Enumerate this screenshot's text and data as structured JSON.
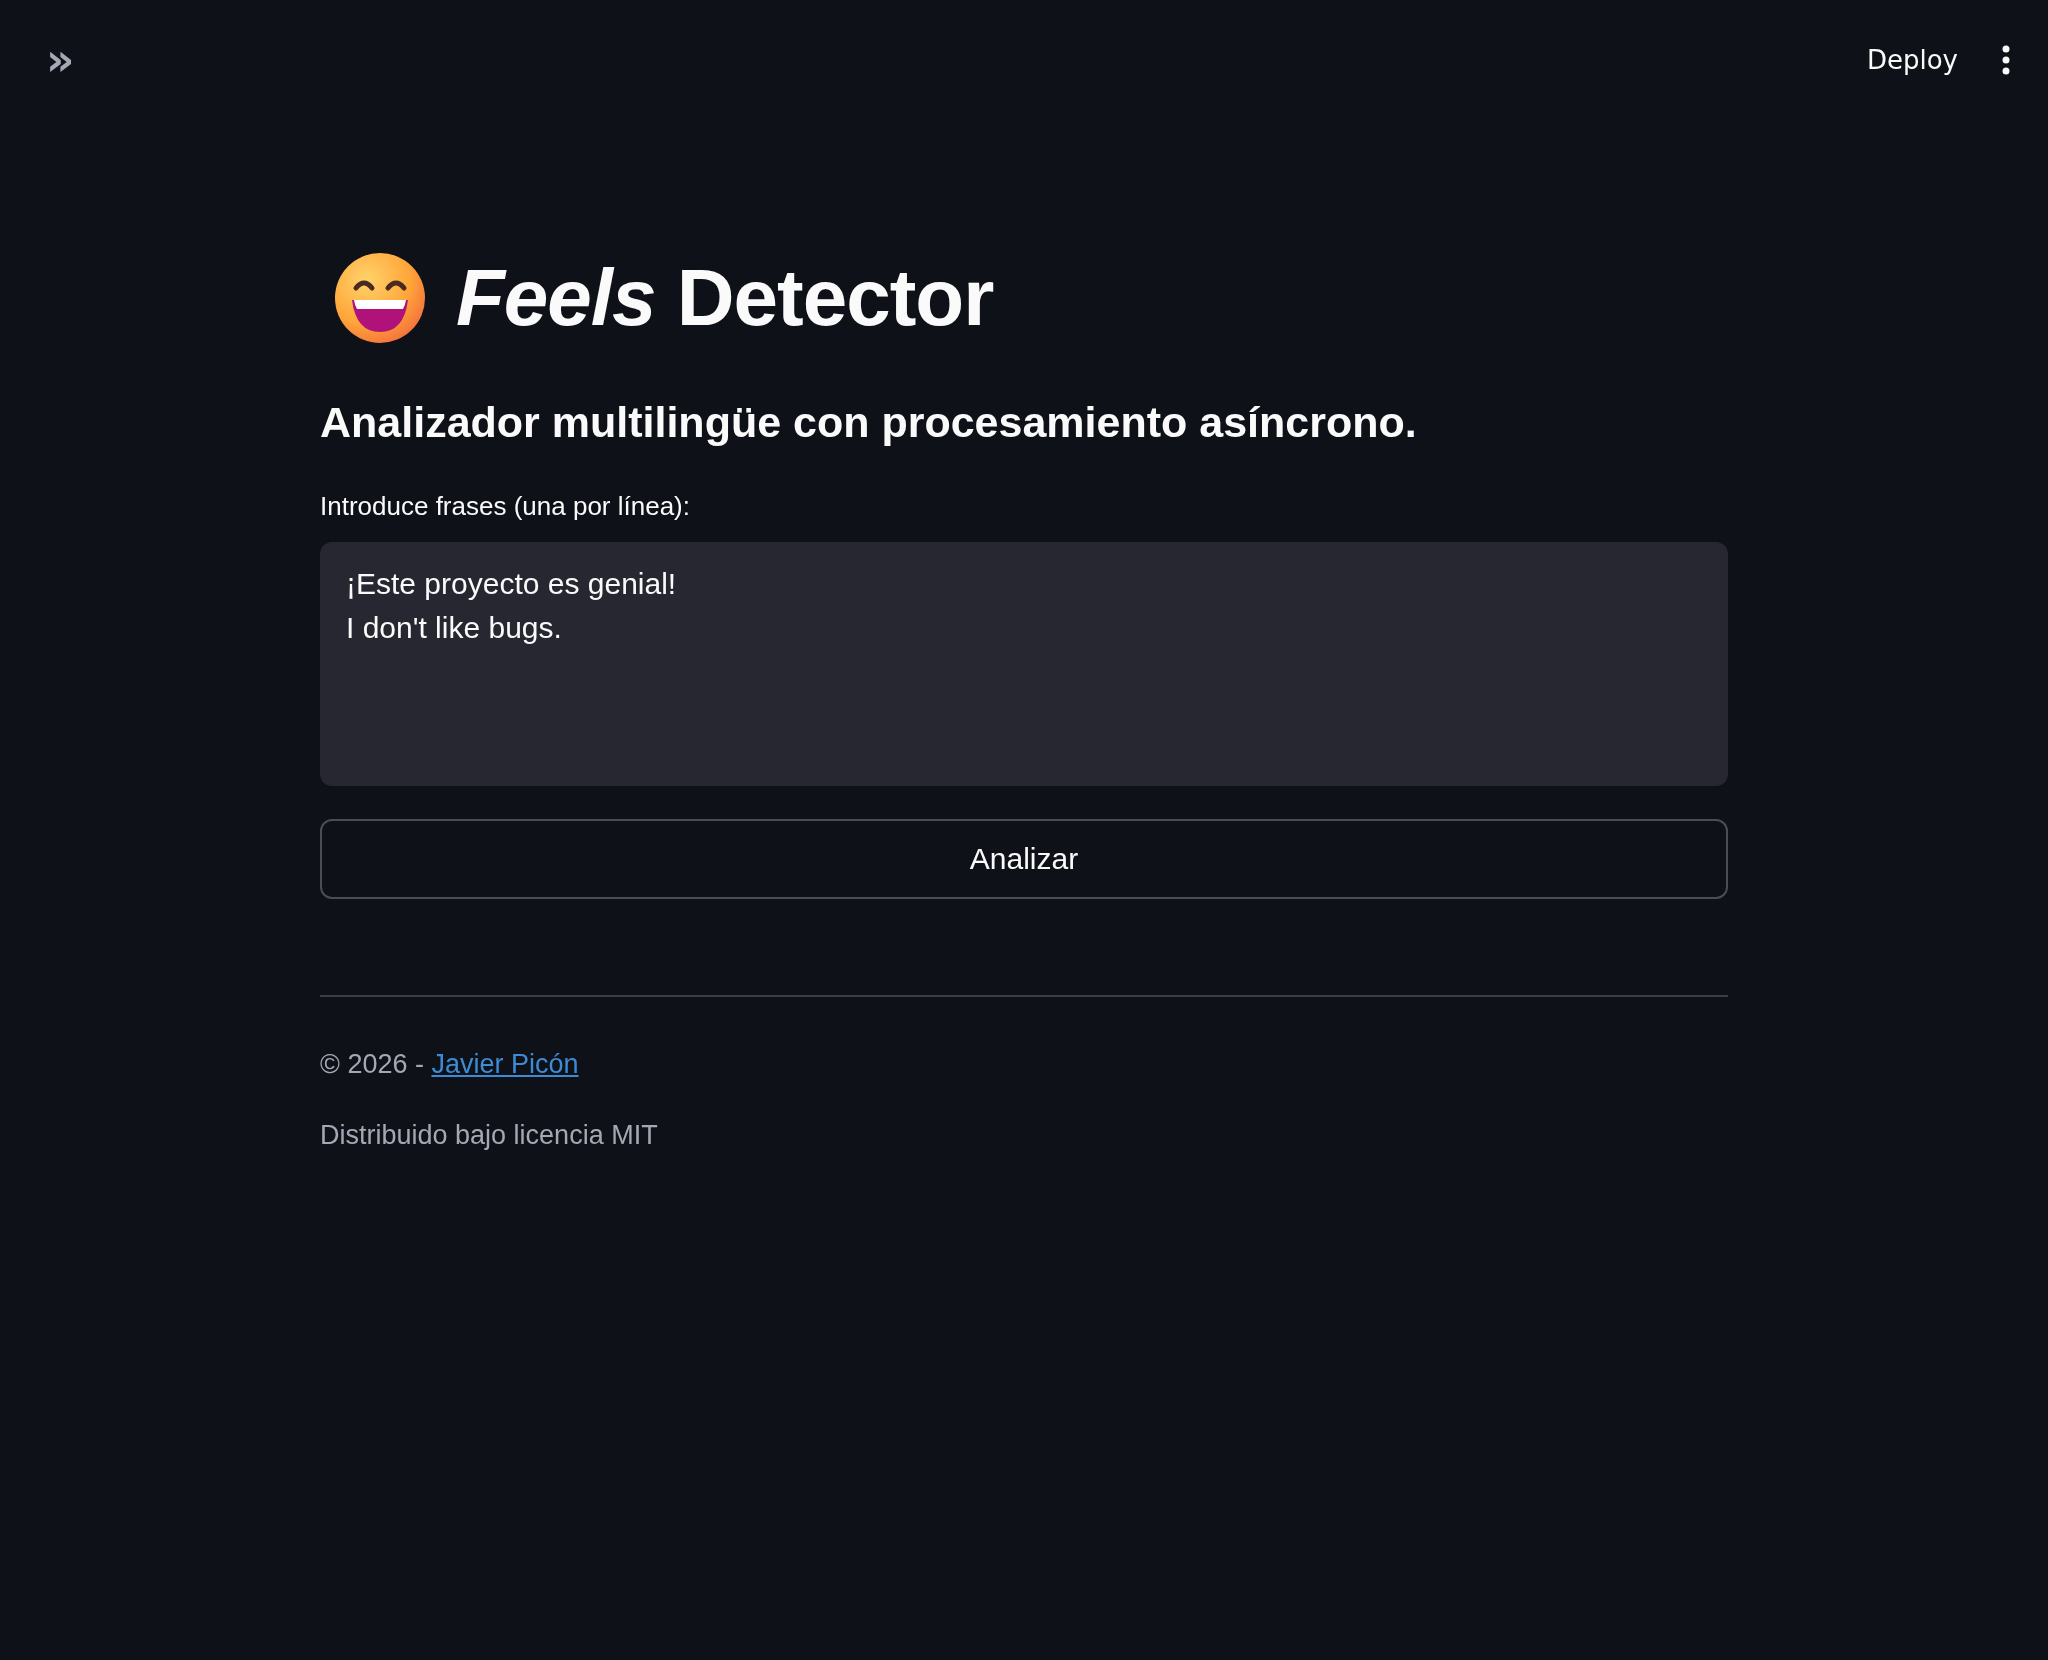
{
  "header": {
    "sidebar_toggle": "»",
    "deploy": "Deploy"
  },
  "title": "*Feels* Detector",
  "subtitle": "Analizador multilingüe con procesamiento asíncrono.",
  "input": {
    "label": "Introduce frases (una por línea):",
    "value": "¡Este proyecto es genial!\nI don't like bugs."
  },
  "button": "Analizar",
  "footer": {
    "credit_prefix": "© 2026 - ",
    "author_link": "Javier Picón",
    "license": "Distribuido bajo licencia MIT"
  }
}
